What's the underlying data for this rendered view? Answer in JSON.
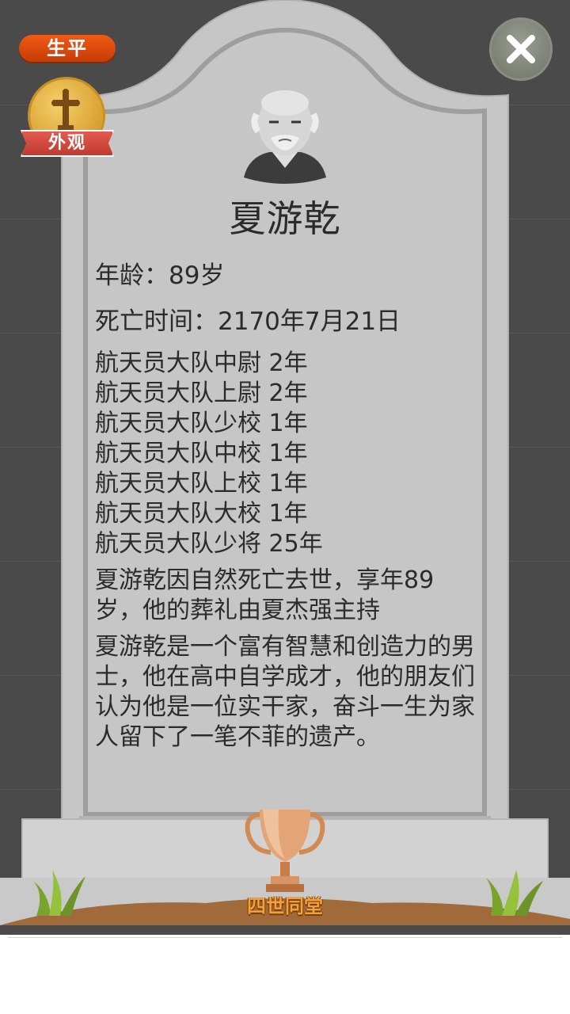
{
  "tabs": {
    "life_label": "生平",
    "appearance_label": "外观"
  },
  "person": {
    "name": "夏游乾",
    "age_line": "年龄：89岁",
    "death_line": "死亡时间：2170年7月21日",
    "career": [
      "航天员大队中尉 2年",
      "航天员大队上尉 2年",
      "航天员大队少校 1年",
      "航天员大队中校 1年",
      "航天员大队上校 1年",
      "航天员大队大校 1年",
      "航天员大队少将 25年"
    ],
    "death_summary": "夏游乾因自然死亡去世，享年89岁，他的葬礼由夏杰强主持",
    "biography": "夏游乾是一个富有智慧和创造力的男士，他在高中自学成才，他的朋友们认为他是一位实干家，奋斗一生为家人留下了一笔不菲的遗产。"
  },
  "achievement": {
    "title": "四世同堂",
    "icon": "trophy-icon"
  },
  "icons": {
    "close": "close-icon",
    "cross": "cross-icon",
    "avatar": "elder-man-avatar"
  },
  "colors": {
    "tab_orange": "#e4500c",
    "ribbon_red": "#d24a3d",
    "stone": "#c8c8c8",
    "trophy": "#e0a070"
  }
}
